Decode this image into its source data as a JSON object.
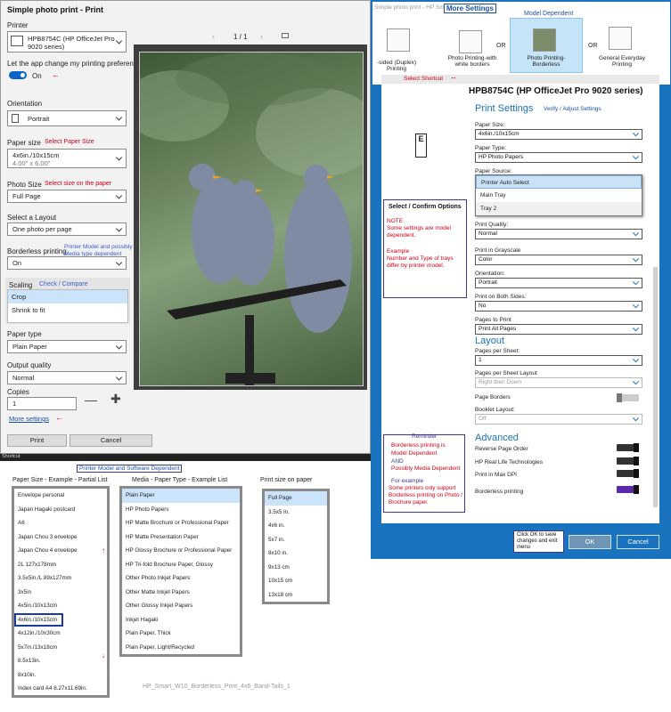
{
  "print_dialog": {
    "title": "Simple photo print - Print",
    "printer_label": "Printer",
    "printer_value_line1": "HPB8754C (HP OfficeJet Pro",
    "printer_value_line2": "9020 series)",
    "app_pref_label": "Let the app change my printing preferences",
    "toggle_state": "On",
    "orientation_label": "Orientation",
    "orientation_value": "Portrait",
    "paper_size_label": "Paper size",
    "paper_size_note": "Select Paper Size",
    "paper_size_value": "4x6in./10x15cm",
    "paper_size_sub": "4.00\" x 6.00\"",
    "photo_size_label": "Photo Size",
    "photo_size_note": "Select size on the paper",
    "photo_size_value": "Full Page",
    "layout_label": "Select a Layout",
    "layout_value": "One photo per page",
    "borderless_label": "Borderless printing",
    "borderless_note_line1": "Printer Model and possibly",
    "borderless_note_line2": "Media type dependent",
    "borderless_value": "On",
    "scaling_label": "Scaling",
    "scaling_note": "Check / Compare",
    "scaling_options": [
      "Crop",
      "Shrink to fit"
    ],
    "paper_type_label": "Paper type",
    "paper_type_value": "Plain Paper",
    "output_quality_label": "Output quality",
    "output_quality_value": "Normal",
    "copies_label": "Copies",
    "copies_value": "1",
    "more_settings_link": "More settings",
    "page_indicator": "1 / 1",
    "print_button": "Print",
    "cancel_button": "Cancel",
    "shortcut_label": "Shortcut"
  },
  "hp_dialog": {
    "title": "Simple photo print - HP Smart",
    "more_settings_tab": "More Settings",
    "model_dependent_note": "Model Dependent",
    "presets": [
      {
        "label": "-sided (Duplex) Printing"
      },
      {
        "label": "Photo Printing-with white borders"
      },
      {
        "label": "Photo Printing-Borderless"
      },
      {
        "label": "General Everyday Printing"
      }
    ],
    "or_text": "OR",
    "select_shortcut": "Select Shortcut",
    "printer_name": "HPB8754C (HP OfficeJet Pro 9020 series)",
    "print_settings_heading": "Print Settings",
    "verify_note": "Verify / Adjust Settings",
    "preview_letter": "E",
    "fields": {
      "paper_size_label": "Paper Size:",
      "paper_size_value": "4x6in./10x15cm",
      "paper_type_label": "Paper Type:",
      "paper_type_value": "HP Photo Papers",
      "paper_source_label": "Paper Source:",
      "paper_source_options": [
        "Printer Auto Select",
        "Main Tray",
        "Tray 2"
      ],
      "print_quality_label": "Print Quality:",
      "print_quality_value": "Normal",
      "grayscale_label": "Print in Grayscale",
      "grayscale_value": "Color",
      "orientation_label": "Orientation:",
      "orientation_value": "Portrait",
      "both_sides_label": "Print on Both Sides:",
      "both_sides_value": "No",
      "pages_label": "Pages to Print",
      "pages_value": "Print All Pages"
    },
    "layout_heading": "Layout",
    "layout": {
      "pps_label": "Pages per Sheet:",
      "pps_value": "1",
      "pps_layout_label": "Pages per Sheet Layout",
      "pps_layout_value": "Right then Down",
      "page_borders_label": "Page Borders",
      "booklet_label": "Booklet Layout:",
      "booklet_value": "Off"
    },
    "advanced_heading": "Advanced",
    "advanced": {
      "reverse_label": "Reverse Page Order",
      "real_life_label": "HP Real Life Technologies",
      "max_dpi_label": "Print in Max DPI",
      "borderless_label": "Borderless printing"
    },
    "select_confirm_title": "Select / Confirm Options",
    "note_title": "NOTE",
    "note_body": "Some settings are model dependent.",
    "example_title": "Example",
    "example_body": "Number and Type of trays differ by printer model.",
    "reminder_title": "Reminder",
    "reminder_line1": "Borderless printing is",
    "reminder_line2": "Model Dependent",
    "reminder_line3": "AND",
    "reminder_line4": "Possibly Media Dependent",
    "reminder_example": "For example",
    "reminder_example_body": "Some printers only support Borderless printing on Photo / Brochure paper.",
    "ok_hint": "Click OK to save changes and exit menu",
    "ok_button": "OK",
    "cancel_button": "Cancel"
  },
  "bottom": {
    "model_note": "Printer Model and Software Dependent",
    "paper_size_title": "Paper Size - Example - Partial List",
    "paper_sizes": [
      "Envelope personal",
      "Japan Hagaki postcard",
      "A6",
      "Japan Chou 3 envelope",
      "Japan Chou 4 envelope",
      "2L 127x178mm",
      "3.5x5in./L 89x127mm",
      "3x5in",
      "4x5in./10x13cm",
      "4x6in./10x15cm",
      "4x12in./10x30cm",
      "5x7in./13x18cm",
      "8.5x13in.",
      "8x10in.",
      "Index card A4 8.27x11.69in."
    ],
    "media_title": "Media - Paper Type - Example List",
    "media_types": [
      "Plain Paper",
      "HP Photo Papers",
      "HP Matte Brochure or Professional Paper",
      "HP Matte Presentation Paper",
      "HP Glossy Brochure or Professional Paper",
      "HP Tri-fold Brochure Paper, Glossy",
      "Other Photo Inkjet Papers",
      "Other Matte Inkjet Papers",
      "Other Glossy Inkjet Papers",
      "Inkjet Hagaki",
      "Plain Paper, Thick",
      "Plain Paper, Light/Recycled"
    ],
    "print_size_title": "Print size on paper",
    "print_sizes": [
      "Full Page",
      "3.5x5 in.",
      "4x6 in.",
      "5x7 in.",
      "8x10 in.",
      "9x13 cm",
      "10x15 cm",
      "13x18 cm"
    ],
    "caption": "HP_Smart_W10_Borderless_Print_4x6_Band-Tails_1"
  }
}
